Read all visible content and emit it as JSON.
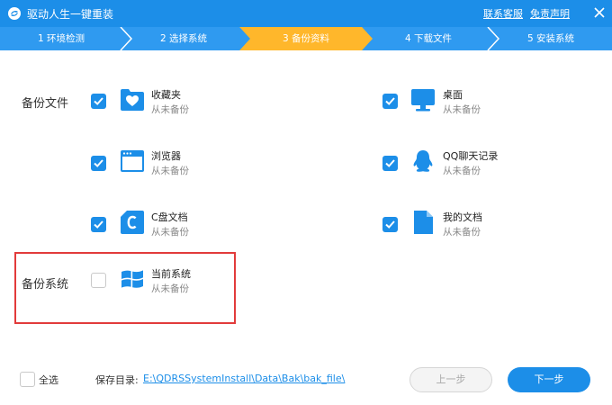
{
  "titlebar": {
    "title": "驱动人生一键重装",
    "contact_link": "联系客服",
    "disclaimer_link": "免责声明",
    "bg_color": "#1c8ee8"
  },
  "steps": [
    {
      "label": "1 环境检测",
      "active": false
    },
    {
      "label": "2 选择系统",
      "active": false
    },
    {
      "label": "3 备份资料",
      "active": true
    },
    {
      "label": "4 下载文件",
      "active": false
    },
    {
      "label": "5 安装系统",
      "active": false
    }
  ],
  "sections": {
    "backup_files_label": "备份文件",
    "backup_system_label": "备份系统"
  },
  "items": {
    "favorites": {
      "name": "收藏夹",
      "status": "从未备份",
      "checked": true,
      "icon": "heart-folder-icon"
    },
    "desktop": {
      "name": "桌面",
      "status": "从未备份",
      "checked": true,
      "icon": "monitor-icon"
    },
    "browser": {
      "name": "浏览器",
      "status": "从未备份",
      "checked": true,
      "icon": "browser-window-icon"
    },
    "qq_chat": {
      "name": "QQ聊天记录",
      "status": "从未备份",
      "checked": true,
      "icon": "penguin-icon"
    },
    "c_drive_docs": {
      "name": "C盘文档",
      "status": "从未备份",
      "checked": true,
      "icon": "c-document-icon"
    },
    "my_documents": {
      "name": "我的文档",
      "status": "从未备份",
      "checked": true,
      "icon": "document-icon"
    },
    "current_system": {
      "name": "当前系统",
      "status": "从未备份",
      "checked": false,
      "icon": "windows-logo-icon"
    }
  },
  "footer": {
    "select_all_label": "全选",
    "select_all_checked": false,
    "save_dir_label": "保存目录:",
    "save_dir_path": "E:\\QDRSSystemInstall\\Data\\Bak\\bak_file\\",
    "prev_button": "上一步",
    "next_button": "下一步"
  },
  "colors": {
    "accent": "#1c8ee8",
    "active_step": "#ffb72b",
    "highlight_box": "#e23b3b"
  }
}
